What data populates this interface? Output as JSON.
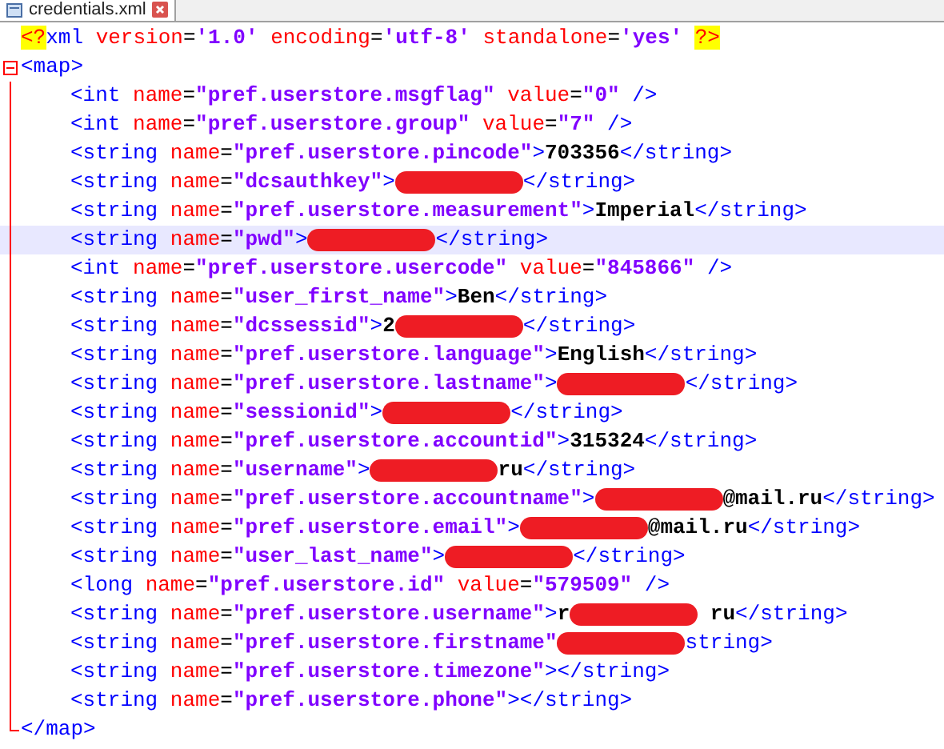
{
  "tab": {
    "label": "credentials.xml",
    "selected": true
  },
  "lines": [
    {
      "tokens": [
        {
          "kind": "pi",
          "text": "<?"
        },
        {
          "kind": "tag",
          "text": "xml "
        },
        {
          "kind": "attr",
          "text": "version"
        },
        {
          "kind": "eq",
          "text": "="
        },
        {
          "kind": "value",
          "text": "'1.0' "
        },
        {
          "kind": "attr",
          "text": "encoding"
        },
        {
          "kind": "eq",
          "text": "="
        },
        {
          "kind": "value",
          "text": "'utf-8' "
        },
        {
          "kind": "attr",
          "text": "standalone"
        },
        {
          "kind": "eq",
          "text": "="
        },
        {
          "kind": "value",
          "text": "'yes' "
        },
        {
          "kind": "pi",
          "text": "?>"
        }
      ],
      "current": false
    },
    {
      "tokens": [
        {
          "kind": "tag",
          "text": "<map>"
        }
      ],
      "current": false,
      "expanded": true,
      "children": [
        {
          "tokens": [
            {
              "kind": "tag",
              "text": "<int "
            },
            {
              "kind": "attr",
              "text": "name"
            },
            {
              "kind": "eq",
              "text": "="
            },
            {
              "kind": "value",
              "text": "\"pref.userstore.msgflag\""
            },
            {
              "kind": "attr",
              "text": " value"
            },
            {
              "kind": "eq",
              "text": "="
            },
            {
              "kind": "value",
              "text": "\"0\""
            },
            {
              "kind": "tag",
              "text": " />"
            }
          ],
          "current": false
        },
        {
          "tokens": [
            {
              "kind": "tag",
              "text": "<int "
            },
            {
              "kind": "attr",
              "text": "name"
            },
            {
              "kind": "eq",
              "text": "="
            },
            {
              "kind": "value",
              "text": "\"pref.userstore.group\""
            },
            {
              "kind": "attr",
              "text": " value"
            },
            {
              "kind": "eq",
              "text": "="
            },
            {
              "kind": "value",
              "text": "\"7\""
            },
            {
              "kind": "tag",
              "text": " />"
            }
          ],
          "current": false
        },
        {
          "tokens": [
            {
              "kind": "tag",
              "text": "<string "
            },
            {
              "kind": "attr",
              "text": "name"
            },
            {
              "kind": "eq",
              "text": "="
            },
            {
              "kind": "value",
              "text": "\"pref.userstore.pincode\""
            },
            {
              "kind": "tag",
              "text": ">"
            },
            {
              "kind": "text",
              "text": "703356"
            },
            {
              "kind": "tag",
              "text": "</string>"
            }
          ],
          "current": false
        },
        {
          "tokens": [
            {
              "kind": "tag",
              "text": "<string "
            },
            {
              "kind": "attr",
              "text": "name"
            },
            {
              "kind": "eq",
              "text": "="
            },
            {
              "kind": "value",
              "text": "\"dcsauthkey\""
            },
            {
              "kind": "tag",
              "text": ">"
            },
            {
              "kind": "redaction"
            },
            {
              "kind": "tag",
              "text": "</string>"
            }
          ],
          "current": false
        },
        {
          "tokens": [
            {
              "kind": "tag",
              "text": "<string "
            },
            {
              "kind": "attr",
              "text": "name"
            },
            {
              "kind": "eq",
              "text": "="
            },
            {
              "kind": "value",
              "text": "\"pref.userstore.measurement\""
            },
            {
              "kind": "tag",
              "text": ">"
            },
            {
              "kind": "text",
              "text": "Imperial"
            },
            {
              "kind": "tag",
              "text": "</string>"
            }
          ],
          "current": false
        },
        {
          "tokens": [
            {
              "kind": "tag",
              "text": "<string "
            },
            {
              "kind": "attr",
              "text": "name"
            },
            {
              "kind": "eq",
              "text": "="
            },
            {
              "kind": "value",
              "text": "\"pwd\""
            },
            {
              "kind": "tag",
              "text": ">"
            },
            {
              "kind": "redaction"
            },
            {
              "kind": "tag",
              "text": "</string>"
            }
          ],
          "current": true
        },
        {
          "tokens": [
            {
              "kind": "tag",
              "text": "<int "
            },
            {
              "kind": "attr",
              "text": "name"
            },
            {
              "kind": "eq",
              "text": "="
            },
            {
              "kind": "value",
              "text": "\"pref.userstore.usercode\""
            },
            {
              "kind": "attr",
              "text": " value"
            },
            {
              "kind": "eq",
              "text": "="
            },
            {
              "kind": "value",
              "text": "\"845866\""
            },
            {
              "kind": "tag",
              "text": " />"
            }
          ],
          "current": false
        },
        {
          "tokens": [
            {
              "kind": "tag",
              "text": "<string "
            },
            {
              "kind": "attr",
              "text": "name"
            },
            {
              "kind": "eq",
              "text": "="
            },
            {
              "kind": "value",
              "text": "\"user_first_name\""
            },
            {
              "kind": "tag",
              "text": ">"
            },
            {
              "kind": "text",
              "text": "Ben"
            },
            {
              "kind": "tag",
              "text": "</string>"
            }
          ],
          "current": false
        },
        {
          "tokens": [
            {
              "kind": "tag",
              "text": "<string "
            },
            {
              "kind": "attr",
              "text": "name"
            },
            {
              "kind": "eq",
              "text": "="
            },
            {
              "kind": "value",
              "text": "\"dcssessid\""
            },
            {
              "kind": "tag",
              "text": ">"
            },
            {
              "kind": "text",
              "text": "2"
            },
            {
              "kind": "redaction"
            },
            {
              "kind": "tag",
              "text": "</string>"
            }
          ],
          "current": false
        },
        {
          "tokens": [
            {
              "kind": "tag",
              "text": "<string "
            },
            {
              "kind": "attr",
              "text": "name"
            },
            {
              "kind": "eq",
              "text": "="
            },
            {
              "kind": "value",
              "text": "\"pref.userstore.language\""
            },
            {
              "kind": "tag",
              "text": ">"
            },
            {
              "kind": "text",
              "text": "English"
            },
            {
              "kind": "tag",
              "text": "</string>"
            }
          ],
          "current": false
        },
        {
          "tokens": [
            {
              "kind": "tag",
              "text": "<string "
            },
            {
              "kind": "attr",
              "text": "name"
            },
            {
              "kind": "eq",
              "text": "="
            },
            {
              "kind": "value",
              "text": "\"pref.userstore.lastname\""
            },
            {
              "kind": "tag",
              "text": ">"
            },
            {
              "kind": "redaction"
            },
            {
              "kind": "tag",
              "text": "</string>"
            }
          ],
          "current": false
        },
        {
          "tokens": [
            {
              "kind": "tag",
              "text": "<string "
            },
            {
              "kind": "attr",
              "text": "name"
            },
            {
              "kind": "eq",
              "text": "="
            },
            {
              "kind": "value",
              "text": "\"sessionid\""
            },
            {
              "kind": "tag",
              "text": ">"
            },
            {
              "kind": "redaction"
            },
            {
              "kind": "tag",
              "text": "</string>"
            }
          ],
          "current": false
        },
        {
          "tokens": [
            {
              "kind": "tag",
              "text": "<string "
            },
            {
              "kind": "attr",
              "text": "name"
            },
            {
              "kind": "eq",
              "text": "="
            },
            {
              "kind": "value",
              "text": "\"pref.userstore.accountid\""
            },
            {
              "kind": "tag",
              "text": ">"
            },
            {
              "kind": "text",
              "text": "315324"
            },
            {
              "kind": "tag",
              "text": "</string>"
            }
          ],
          "current": false
        },
        {
          "tokens": [
            {
              "kind": "tag",
              "text": "<string "
            },
            {
              "kind": "attr",
              "text": "name"
            },
            {
              "kind": "eq",
              "text": "="
            },
            {
              "kind": "value",
              "text": "\"username\""
            },
            {
              "kind": "tag",
              "text": ">"
            },
            {
              "kind": "redaction"
            },
            {
              "kind": "text",
              "text": "ru"
            },
            {
              "kind": "tag",
              "text": "</string>"
            }
          ],
          "current": false
        },
        {
          "tokens": [
            {
              "kind": "tag",
              "text": "<string "
            },
            {
              "kind": "attr",
              "text": "name"
            },
            {
              "kind": "eq",
              "text": "="
            },
            {
              "kind": "value",
              "text": "\"pref.userstore.accountname\""
            },
            {
              "kind": "tag",
              "text": ">"
            },
            {
              "kind": "redaction"
            },
            {
              "kind": "text",
              "text": "@mail.ru"
            },
            {
              "kind": "tag",
              "text": "</string>"
            }
          ],
          "current": false
        },
        {
          "tokens": [
            {
              "kind": "tag",
              "text": "<string "
            },
            {
              "kind": "attr",
              "text": "name"
            },
            {
              "kind": "eq",
              "text": "="
            },
            {
              "kind": "value",
              "text": "\"pref.userstore.email\""
            },
            {
              "kind": "tag",
              "text": ">"
            },
            {
              "kind": "redaction"
            },
            {
              "kind": "text",
              "text": "@mail.ru"
            },
            {
              "kind": "tag",
              "text": "</string>"
            }
          ],
          "current": false
        },
        {
          "tokens": [
            {
              "kind": "tag",
              "text": "<string "
            },
            {
              "kind": "attr",
              "text": "name"
            },
            {
              "kind": "eq",
              "text": "="
            },
            {
              "kind": "value",
              "text": "\"user_last_name\""
            },
            {
              "kind": "tag",
              "text": ">"
            },
            {
              "kind": "redaction"
            },
            {
              "kind": "tag",
              "text": "</string>"
            }
          ],
          "current": false
        },
        {
          "tokens": [
            {
              "kind": "tag",
              "text": "<long "
            },
            {
              "kind": "attr",
              "text": "name"
            },
            {
              "kind": "eq",
              "text": "="
            },
            {
              "kind": "value",
              "text": "\"pref.userstore.id\""
            },
            {
              "kind": "attr",
              "text": " value"
            },
            {
              "kind": "eq",
              "text": "="
            },
            {
              "kind": "value",
              "text": "\"579509\""
            },
            {
              "kind": "tag",
              "text": " />"
            }
          ],
          "current": false
        },
        {
          "tokens": [
            {
              "kind": "tag",
              "text": "<string "
            },
            {
              "kind": "attr",
              "text": "name"
            },
            {
              "kind": "eq",
              "text": "="
            },
            {
              "kind": "value",
              "text": "\"pref.userstore.username\""
            },
            {
              "kind": "tag",
              "text": ">"
            },
            {
              "kind": "text",
              "text": "r"
            },
            {
              "kind": "redaction"
            },
            {
              "kind": "text",
              "text": " ru"
            },
            {
              "kind": "tag",
              "text": "</string>"
            }
          ],
          "current": false
        },
        {
          "tokens": [
            {
              "kind": "tag",
              "text": "<string "
            },
            {
              "kind": "attr",
              "text": "name"
            },
            {
              "kind": "eq",
              "text": "="
            },
            {
              "kind": "value",
              "text": "\"pref.userstore.firstname\""
            },
            {
              "kind": "redaction"
            },
            {
              "kind": "tag",
              "text": "string>"
            }
          ],
          "current": false
        },
        {
          "tokens": [
            {
              "kind": "tag",
              "text": "<string "
            },
            {
              "kind": "attr",
              "text": "name"
            },
            {
              "kind": "eq",
              "text": "="
            },
            {
              "kind": "value",
              "text": "\"pref.userstore.timezone\""
            },
            {
              "kind": "tag",
              "text": "></string>"
            }
          ],
          "current": false
        },
        {
          "tokens": [
            {
              "kind": "tag",
              "text": "<string "
            },
            {
              "kind": "attr",
              "text": "name"
            },
            {
              "kind": "eq",
              "text": "="
            },
            {
              "kind": "value",
              "text": "\"pref.userstore.phone\""
            },
            {
              "kind": "tag",
              "text": "></string>"
            }
          ],
          "current": false
        }
      ]
    },
    {
      "tokens": [
        {
          "kind": "tag",
          "text": "</map>"
        }
      ],
      "current": false,
      "closes": true
    }
  ]
}
